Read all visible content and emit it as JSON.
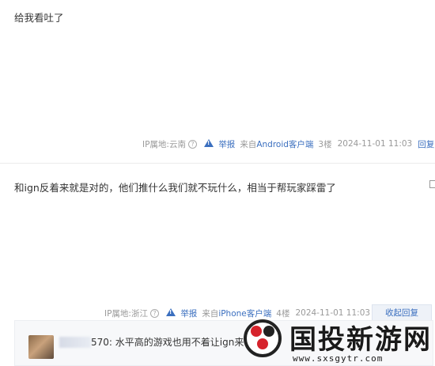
{
  "posts": [
    {
      "content": "给我看吐了",
      "ip_label": "IP属地:云南",
      "report_label": "举报",
      "from_prefix": "来自",
      "device": "Android客户端",
      "floor": "3楼",
      "time": "2024-11-01 11:03",
      "action_label": "回复"
    },
    {
      "content": "和ign反着来就是对的，他们推什么我们就不玩什么，相当于帮玩家踩雷了",
      "ip_label": "IP属地:浙江",
      "report_label": "举报",
      "from_prefix": "来自",
      "device": "iPhone客户端",
      "floor": "4楼",
      "time": "2024-11-01 11:03",
      "action_label": "收起回复",
      "subreply": {
        "text": "570: 水平高的游戏也用不着让ign来"
      }
    }
  ],
  "watermark": {
    "title": "国投新游网",
    "url": "www.sxsgytr.com"
  },
  "colors": {
    "link": "#3b6fbf",
    "meta": "#999999",
    "watermark_red": "#d6232c"
  },
  "icons": {
    "question": "question-circle-icon",
    "warning": "warning-triangle-icon"
  }
}
